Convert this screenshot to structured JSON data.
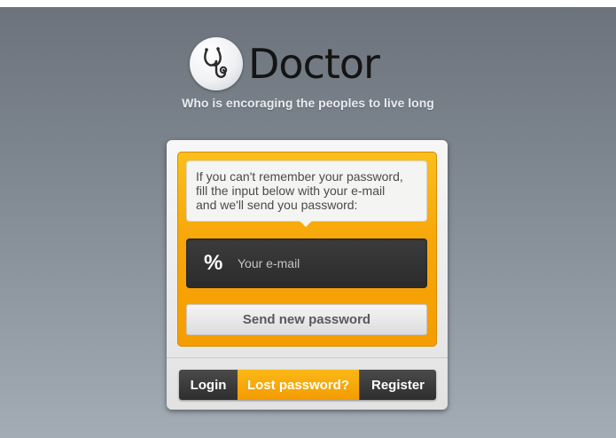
{
  "header": {
    "logo_text": "Doctor",
    "tagline": "Who is encoraging the peoples to live long"
  },
  "form": {
    "instructions": [
      "If you can't remember your password,",
      "fill the input below with your e-mail",
      "and we'll send you password:"
    ],
    "email_icon": "%",
    "email_placeholder": "Your e-mail",
    "submit_label": "Send new password"
  },
  "tabs": {
    "login": "Login",
    "lost_password": "Lost password?",
    "register": "Register",
    "active": "lost_password"
  },
  "colors": {
    "accent": "#f7a70a",
    "dark": "#2e2e2e"
  }
}
